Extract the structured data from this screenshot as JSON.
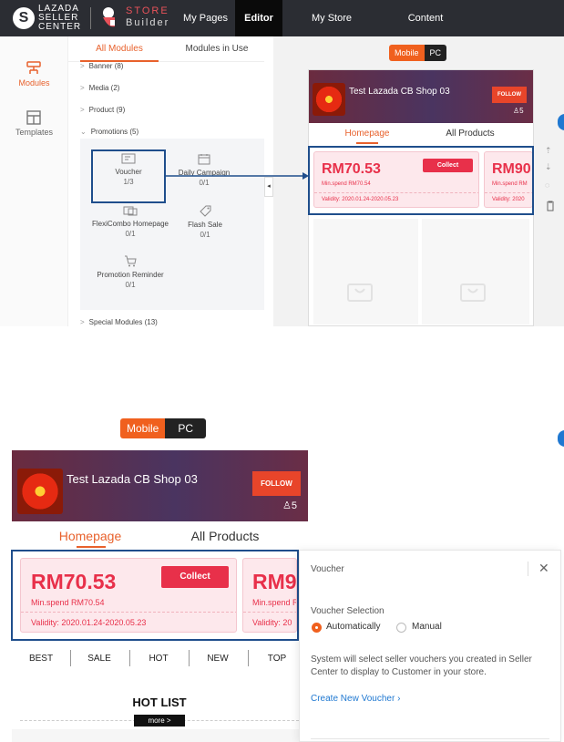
{
  "topbar": {
    "brand_initial": "S",
    "brand_line1": "LAZADA",
    "brand_line2": "SELLER",
    "brand_line3": "CENTER",
    "store_builder_line1": "STORE",
    "store_builder_line2": "Builder",
    "nav": [
      "My Pages",
      "Editor",
      "My Store Categories",
      "Content Generator"
    ],
    "active_nav": "Editor"
  },
  "rail": {
    "items": [
      {
        "label": "Modules",
        "icon": "modules-icon",
        "active": true
      },
      {
        "label": "Templates",
        "icon": "templates-icon",
        "active": false
      }
    ]
  },
  "panel": {
    "tabs": [
      "All Modules",
      "Modules in Use"
    ],
    "categories": {
      "banner": "Banner (8)",
      "media": "Media (2)",
      "product": "Product (9)",
      "promotions": "Promotions (5)",
      "special": "Special Modules (13)"
    },
    "modules": [
      {
        "name": "Voucher",
        "count": "1/3",
        "icon": "voucher-icon"
      },
      {
        "name": "Daily Campaign",
        "count": "0/1",
        "icon": "calendar-icon"
      },
      {
        "name": "FlexiCombo Homepage",
        "count": "0/1",
        "icon": "combo-icon"
      },
      {
        "name": "Flash Sale",
        "count": "0/1",
        "icon": "tag-icon"
      },
      {
        "name": "Promotion Reminder",
        "count": "0/1",
        "icon": "cart-icon"
      }
    ]
  },
  "device_toggle": {
    "mobile": "Mobile",
    "pc": "PC",
    "active": "Mobile"
  },
  "shop": {
    "name": "Test Lazada CB Shop 03",
    "follow_label": "FOLLOW",
    "followers": "5",
    "tabs": [
      "Homepage",
      "All Products"
    ]
  },
  "voucher_card": {
    "amount": "RM70.53",
    "min_spend": "Min.spend RM70.54",
    "validity": "Validity: 2020.01.24-2020.05.23",
    "collect_label": "Collect",
    "next_amount": "RM90",
    "next_amount_bottom": "RM9",
    "next_min_top": "Min.spend RM",
    "next_min_bottom": "Min.spend R",
    "next_valid_top": "Validity: 2020",
    "next_valid_bottom": "Validity: 20"
  },
  "properties": {
    "title": "Voucher",
    "section_label": "Voucher Selection",
    "options": [
      "Automatically",
      "Manual"
    ],
    "selected": "Automatically",
    "description": "System will select seller vouchers you created in Seller Center to display to Customer in your store.",
    "link": "Create New Voucher"
  },
  "category_bar": [
    "BEST",
    "SALE",
    "HOT",
    "NEW",
    "TOP"
  ],
  "hot_list": {
    "title": "HOT LIST",
    "more": "more >"
  },
  "colors": {
    "accent": "#f0601e",
    "highlight": "#1f4e8c",
    "voucher_red": "#e8304a"
  }
}
